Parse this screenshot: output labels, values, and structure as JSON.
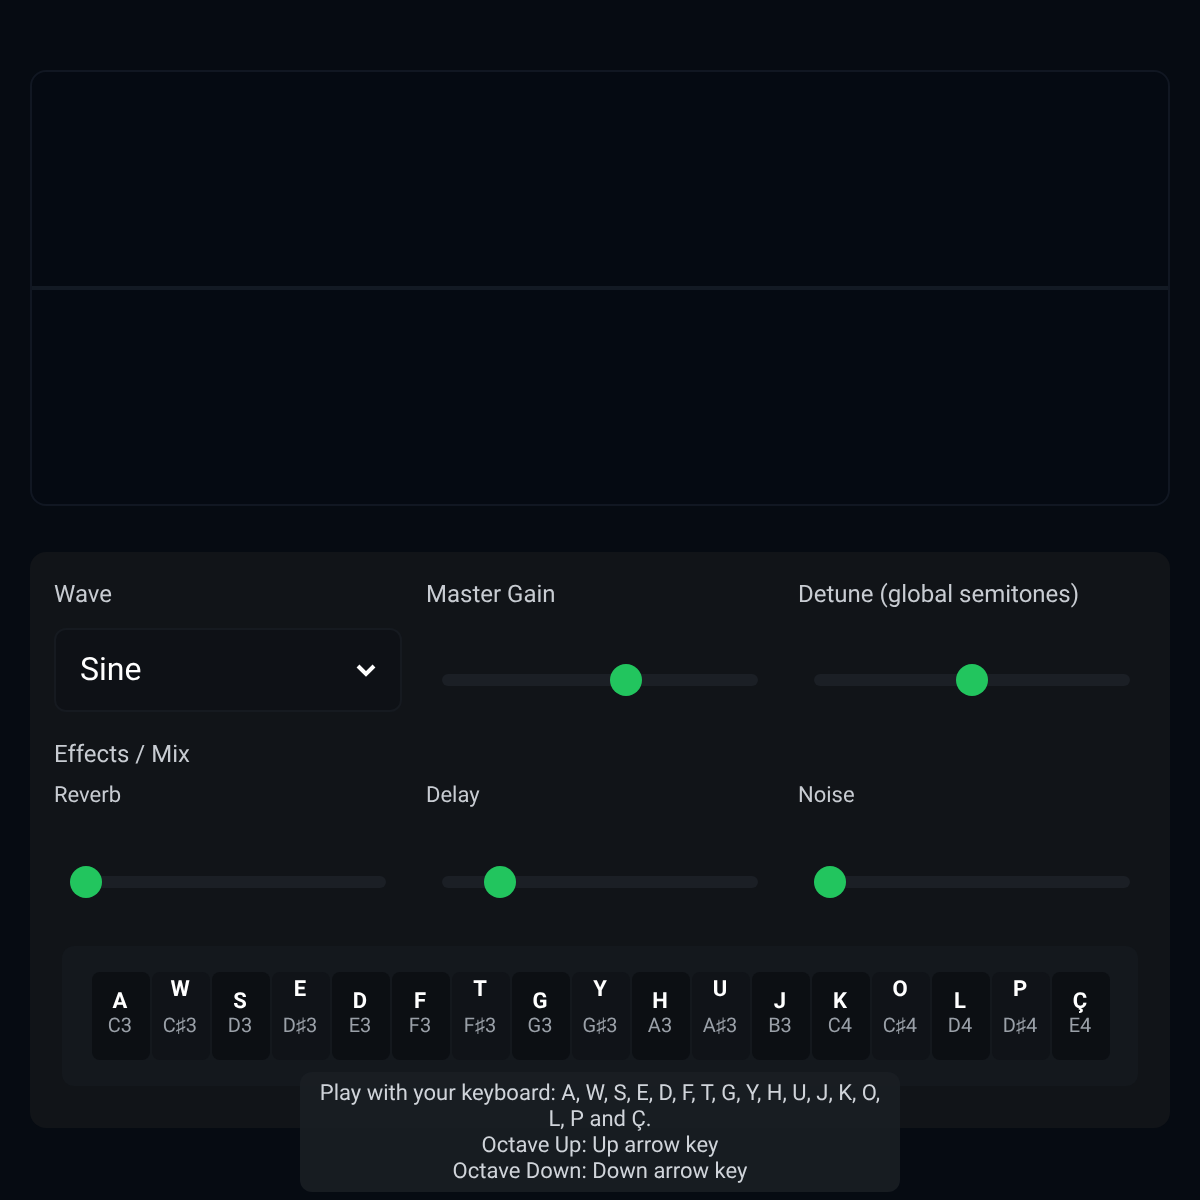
{
  "controls": {
    "wave": {
      "label": "Wave",
      "value": "Sine"
    },
    "master_gain": {
      "label": "Master Gain",
      "level": 0.59
    },
    "detune": {
      "label": "Detune (global semitones)",
      "level": 0.5
    }
  },
  "effects": {
    "title": "Effects / Mix",
    "sliders": [
      {
        "label": "Reverb",
        "level": 0
      },
      {
        "label": "Delay",
        "level": 0.15
      },
      {
        "label": "Noise",
        "level": 0
      }
    ]
  },
  "keyboard": [
    {
      "key": "A",
      "note": "C3",
      "kind": "white"
    },
    {
      "key": "W",
      "note": "C♯3",
      "kind": "black"
    },
    {
      "key": "S",
      "note": "D3",
      "kind": "white"
    },
    {
      "key": "E",
      "note": "D♯3",
      "kind": "black"
    },
    {
      "key": "D",
      "note": "E3",
      "kind": "white"
    },
    {
      "key": "F",
      "note": "F3",
      "kind": "white"
    },
    {
      "key": "T",
      "note": "F♯3",
      "kind": "black"
    },
    {
      "key": "G",
      "note": "G3",
      "kind": "white"
    },
    {
      "key": "Y",
      "note": "G♯3",
      "kind": "black"
    },
    {
      "key": "H",
      "note": "A3",
      "kind": "white"
    },
    {
      "key": "U",
      "note": "A♯3",
      "kind": "black"
    },
    {
      "key": "J",
      "note": "B3",
      "kind": "white"
    },
    {
      "key": "K",
      "note": "C4",
      "kind": "white"
    },
    {
      "key": "O",
      "note": "C♯4",
      "kind": "black"
    },
    {
      "key": "L",
      "note": "D4",
      "kind": "white"
    },
    {
      "key": "P",
      "note": "D♯4",
      "kind": "black"
    },
    {
      "key": "Ç",
      "note": "E4",
      "kind": "white"
    }
  ],
  "tooltip": [
    "Play with your keyboard: A, W, S, E, D, F, T, G, Y, H, U, J, K, O, L, P and Ç.",
    "Octave Up: Up arrow key",
    "Octave Down: Down arrow key"
  ]
}
